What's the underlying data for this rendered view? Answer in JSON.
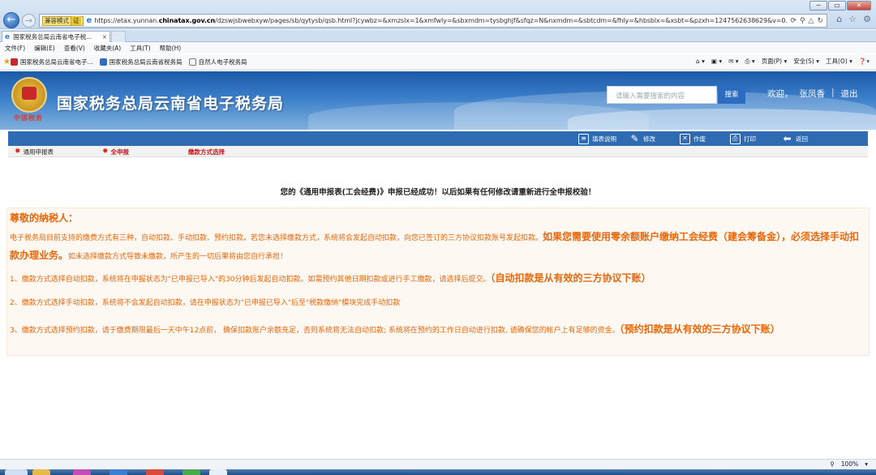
{
  "window": {
    "minimize": "─",
    "maximize": "▭",
    "close": "✕"
  },
  "browser": {
    "back_icon": "arrow-left-icon",
    "compat_label": "兼容模式",
    "compat_value": "证",
    "url_prefix": "https://etax.yunnan.",
    "url_domain": "chinatax.gov.cn",
    "url_suffix": "/dzswjsbwebxyw/pages/sb/qytysb/qsb.html?jcywbz=&xmzslx=1&xmfwly=&sbxmdm=tysbghjf&sfqz=N&nxmdm=&sbtcdm=&fhly=&hbsblx=&xsbt=&pzxh=1247562638629&v=0.",
    "tab_title": "国家税务总局云南省电子税...",
    "tab_close": "×",
    "menu": [
      "文件(F)",
      "编辑(E)",
      "查看(V)",
      "收藏夹(A)",
      "工具(T)",
      "帮助(H)"
    ],
    "favorites": [
      {
        "label": "国家税务总局云南省电子..."
      },
      {
        "label": "国家税务总局云南省税务局"
      },
      {
        "label": "自然人电子税务局"
      }
    ],
    "commands": [
      "页面(P) ▾",
      "安全(S) ▾",
      "工具(O) ▾"
    ],
    "zoom": "100%"
  },
  "site": {
    "title": "国家税务总局云南省电子税务局",
    "search_placeholder": "请输入需要搜索的内容",
    "search_button": "搜索",
    "welcome": "欢迎，",
    "user_name": "张凤香",
    "separator": "|",
    "logout": "退出"
  },
  "toolbar": {
    "fill_help": "填表说明",
    "modify": "修改",
    "void": "作废",
    "print": "打印",
    "back": "返回"
  },
  "steps": [
    {
      "label": "通用申报表"
    },
    {
      "label": "全申报"
    },
    {
      "label": "缴款方式选择"
    }
  ],
  "content": {
    "success_message": "您的《通用申报表(工会经费)》申报已经成功！以后如果有任何修改请重新进行全申报校验！",
    "greeting": "尊敬的纳税人：",
    "p1_text": "电子税务局目前支持的缴费方式有三种，自动扣款、手动扣款、预约扣款。若您未选择缴款方式，系统将会发起自动扣款，向您已签订的三方协议扣款账号发起扣款。",
    "p1_highlight": "如果您需要使用零余额账户缴纳工会经费（建会筹备金），必须选择手动扣款办理业务。",
    "p1_tail": "如未选择缴款方式导致未缴款，所产生的一切后果将由您自行承担！",
    "p2_text": "1、缴款方式选择自动扣款，系统将在申报状态为\"已申报已导入\"的30分钟后发起自动扣款。如需预约其他日期扣款或进行手工缴款，请选择后提交。",
    "p2_highlight": "（自动扣款是从有效的三方协议下账）",
    "p3_text": "2、缴款方式选择手动扣款，系统将不会发起自动扣款，请在申报状态为\"已申报已导入\"后至\"税款缴纳\"模块完成手动扣款",
    "p4_text": "3、缴款方式选择预约扣款，请于缴费期限最后一天中午12点前， 确保扣款账户余额充足，否则系统将无法自动扣款; 系统将在预约的工作日自动进行扣款, 请确保您的帐户上有足够的资金。",
    "p4_highlight": "（预约扣款是从有效的三方协议下账）"
  },
  "colors": {
    "notice_text": "#e8670a",
    "toolbar_bg": "#2e6bb2",
    "active_step": "#c4161c"
  }
}
